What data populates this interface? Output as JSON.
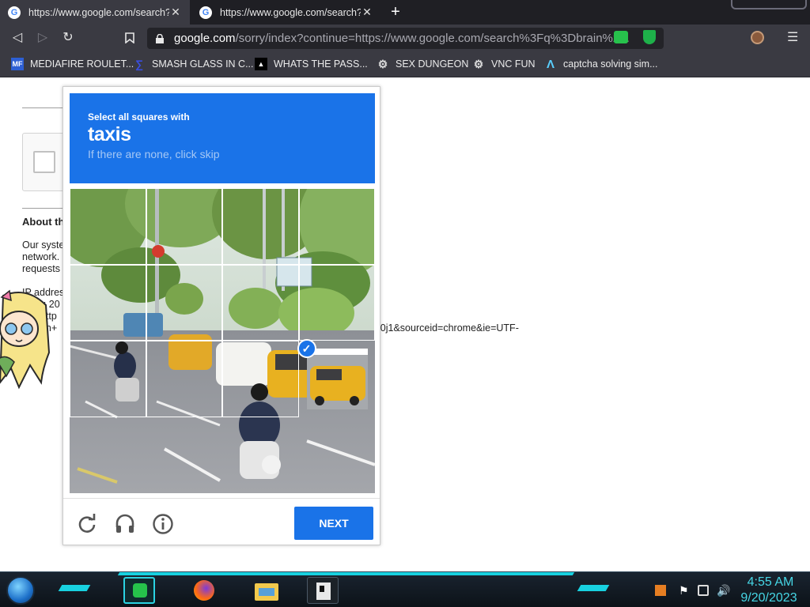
{
  "browser": {
    "tabs": [
      {
        "title": "https://www.google.com/search?q",
        "close": "✕",
        "active": true
      },
      {
        "title": "https://www.google.com/search?q",
        "close": "✕",
        "active": false
      }
    ],
    "new_tab": "+",
    "address": {
      "domain": "google.com",
      "path": "/sorry/index?continue=https://www.google.com/search%3Fq%3Dbrain%2..."
    },
    "bookmarks": [
      {
        "label": "MEDIAFIRE ROULET...",
        "icon": "mediafire-icon"
      },
      {
        "label": "SMASH GLASS IN C...",
        "icon": "smash-icon"
      },
      {
        "label": "WHATS THE PASS...",
        "icon": "password-icon"
      },
      {
        "label": "SEX DUNGEON",
        "icon": "sex-dungeon-icon"
      },
      {
        "label": "VNC FUN",
        "icon": "vnc-icon"
      },
      {
        "label": "captcha solving sim...",
        "icon": "captcha-icon"
      }
    ]
  },
  "page": {
    "about_heading": "About th",
    "lines": [
      "Our syste",
      "network.",
      "requests",
      "IP addres",
      "age: 20",
      ": http",
      "rain+"
    ],
    "url_tail": "j0j1&sourceid=chrome&ie=UTF-"
  },
  "captcha": {
    "instruction": "Select all squares with",
    "target": "taxis",
    "hint": "If there are none, click skip",
    "selected_tiles": [
      8
    ],
    "next_label": "NEXT",
    "colors": {
      "accent": "#1a73e8"
    }
  },
  "taskbar": {
    "clock_time": "4:55 AM",
    "clock_date": "9/20/2023"
  }
}
